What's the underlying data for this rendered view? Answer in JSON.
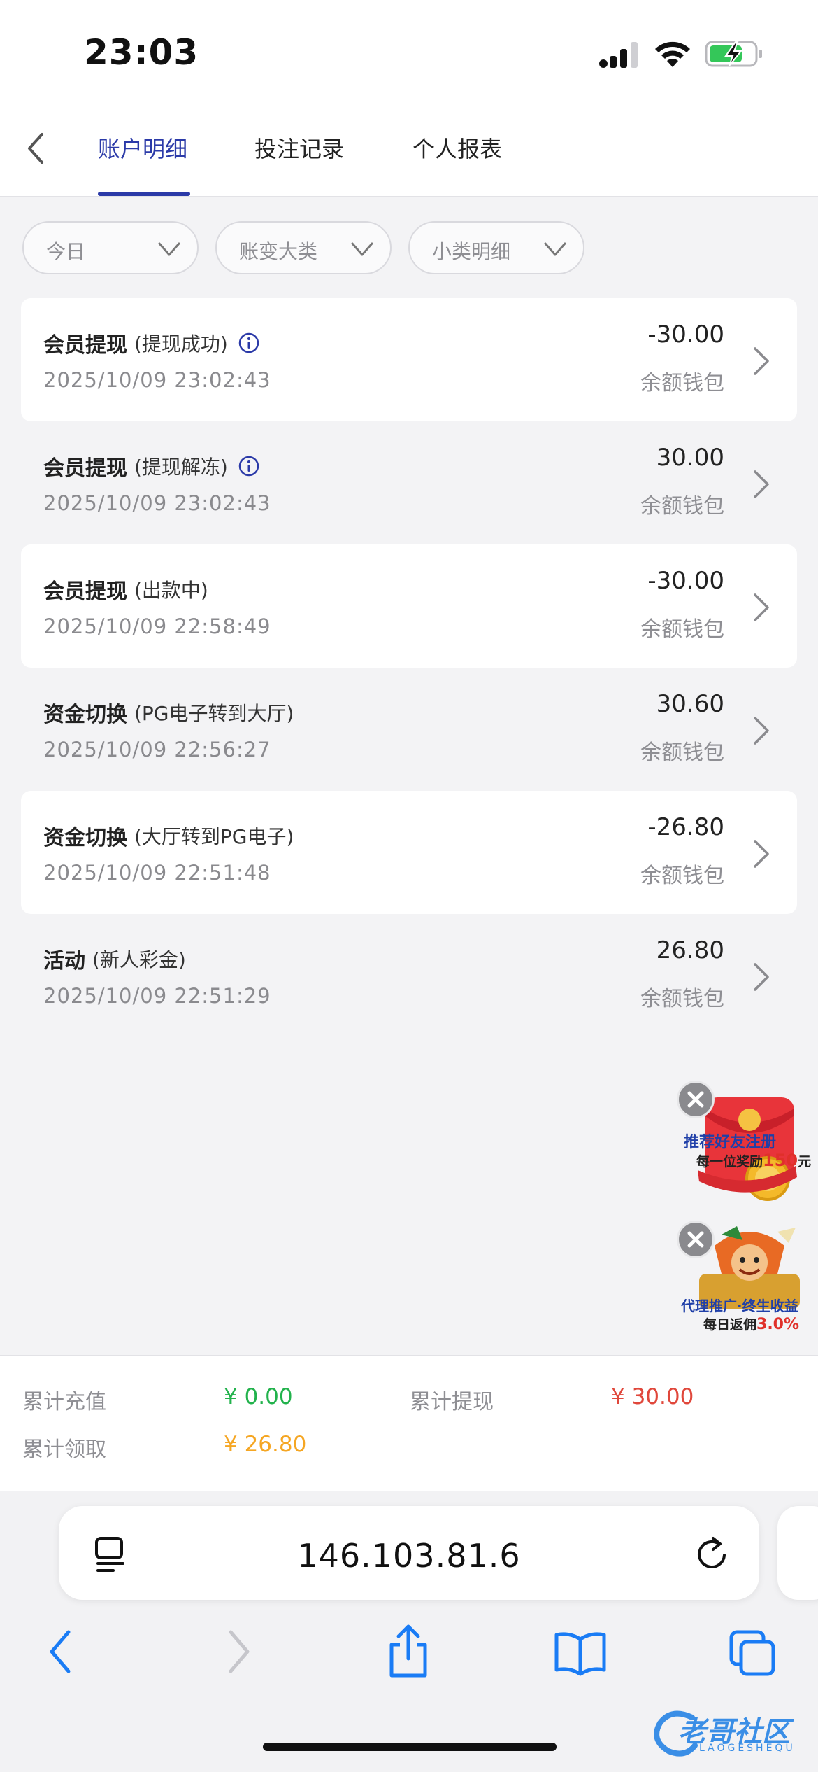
{
  "status_bar": {
    "time": "23:03"
  },
  "header": {
    "tabs": [
      {
        "label": "账户明细",
        "active": true
      },
      {
        "label": "投注记录",
        "active": false
      },
      {
        "label": "个人报表",
        "active": false
      }
    ]
  },
  "filters": [
    {
      "label": "今日"
    },
    {
      "label": "账变大类"
    },
    {
      "label": "小类明细"
    }
  ],
  "records": [
    {
      "title": "会员提现",
      "sub": "(提现成功)",
      "info": true,
      "date": "2025/10/09 23:02:43",
      "amount": "-30.00",
      "wallet": "余额钱包"
    },
    {
      "title": "会员提现",
      "sub": "(提现解冻)",
      "info": true,
      "date": "2025/10/09 23:02:43",
      "amount": "30.00",
      "wallet": "余额钱包"
    },
    {
      "title": "会员提现",
      "sub": "(出款中)",
      "info": false,
      "date": "2025/10/09 22:58:49",
      "amount": "-30.00",
      "wallet": "余额钱包"
    },
    {
      "title": "资金切换",
      "sub": "(PG电子转到大厅)",
      "info": false,
      "date": "2025/10/09 22:56:27",
      "amount": "30.60",
      "wallet": "余额钱包"
    },
    {
      "title": "资金切换",
      "sub": "(大厅转到PG电子)",
      "info": false,
      "date": "2025/10/09 22:51:48",
      "amount": "-26.80",
      "wallet": "余额钱包"
    },
    {
      "title": "活动",
      "sub": "(新人彩金)",
      "info": false,
      "date": "2025/10/09 22:51:29",
      "amount": "26.80",
      "wallet": "余额钱包"
    }
  ],
  "promos": {
    "referral": {
      "line1": "推荐好友注册",
      "line2_prefix": "每一位奖励",
      "line2_amount": "150",
      "line2_suffix": "元"
    },
    "agent": {
      "line1": "代理推广·终生收益",
      "line2_prefix": "每日返佣",
      "line2_amount": "3.0%"
    }
  },
  "summary": {
    "recharge_label": "累计充值",
    "recharge_value": "¥ 0.00",
    "withdraw_label": "累计提现",
    "withdraw_value": "¥ 30.00",
    "claim_label": "累计领取",
    "claim_value": "¥ 26.80"
  },
  "browser": {
    "url": "146.103.81.6"
  },
  "watermark": {
    "text": "老哥社区",
    "sub": "LAOGESHEQU"
  },
  "colors": {
    "accent": "#2b3aa8",
    "green": "#22b24c",
    "red": "#e0473b",
    "orange": "#f5a623",
    "ios_blue": "#1a7cf5"
  },
  "icons": [
    "back-chevron-icon",
    "info-icon",
    "chevron-right-icon",
    "chevron-down-icon",
    "close-icon",
    "tabs-icon",
    "reload-icon",
    "share-icon",
    "bookmarks-icon",
    "tab-switcher-icon"
  ]
}
